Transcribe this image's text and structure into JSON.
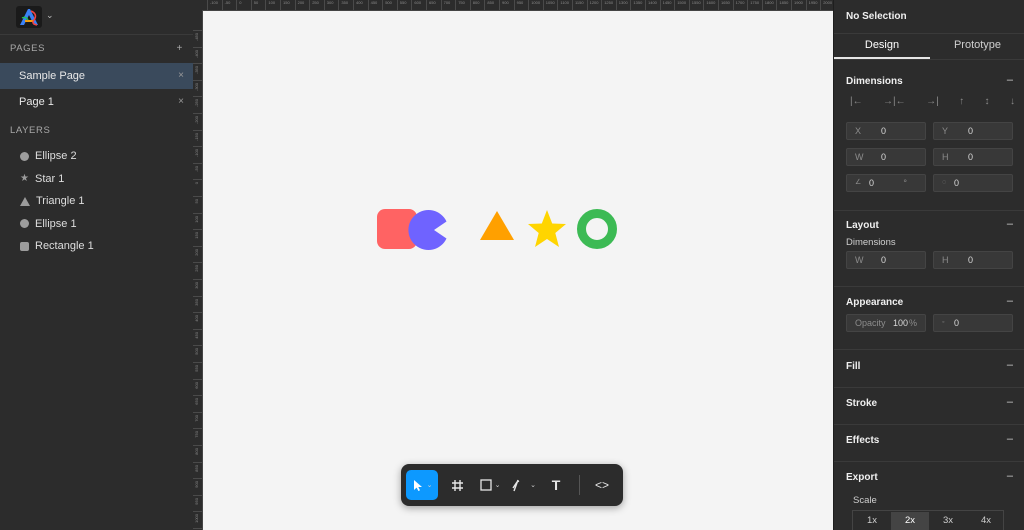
{
  "colors": {
    "canvas_bg": "#f4f4f4",
    "panel_bg": "#2c2c2c",
    "selected_page_bg": "#3a4a5c",
    "accent": "#0d99ff",
    "square": "#ff6363",
    "pacman": "#6f63ff",
    "triangle": "#ffa000",
    "star": "#ffd500",
    "ring": "#3cba54"
  },
  "sidebar": {
    "logo_icon": "app-logo",
    "pages_heading": "PAGES",
    "add_page": "+",
    "pages": [
      {
        "label": "Sample Page",
        "close": "×",
        "active": true
      },
      {
        "label": "Page 1",
        "close": "×",
        "active": false
      }
    ],
    "layers_heading": "LAYERS",
    "layers": [
      {
        "label": "Ellipse 2",
        "icon": "ellipse-icon"
      },
      {
        "label": "Star 1",
        "icon": "star-icon"
      },
      {
        "label": "Triangle 1",
        "icon": "triangle-icon"
      },
      {
        "label": "Ellipse 1",
        "icon": "ellipse-icon"
      },
      {
        "label": "Rectangle 1",
        "icon": "rectangle-icon"
      }
    ]
  },
  "ruler": {
    "top_labels": [
      "-100",
      "-50",
      "0",
      "50",
      "100",
      "150",
      "200",
      "250",
      "300",
      "350",
      "400",
      "450",
      "500",
      "550",
      "600",
      "650",
      "700",
      "750",
      "800",
      "850",
      "900",
      "950",
      "1000",
      "1050",
      "1100",
      "1150",
      "1200",
      "1250",
      "1300",
      "1350",
      "1400",
      "1450",
      "1500",
      "1550",
      "1600",
      "1650",
      "1700",
      "1750",
      "1800",
      "1850",
      "1900",
      "1950",
      "2000",
      "2050"
    ],
    "left_labels": [
      "-450",
      "-400",
      "-350",
      "-300",
      "-250",
      "-200",
      "-150",
      "-100",
      "-50",
      "0",
      "50",
      "100",
      "150",
      "200",
      "250",
      "300",
      "350",
      "400",
      "450",
      "500",
      "550",
      "600",
      "650",
      "700",
      "750",
      "800",
      "850",
      "900",
      "950",
      "1000",
      "1050"
    ]
  },
  "toolbar": {
    "tools": [
      {
        "name": "select-tool",
        "icon": "cursor-icon",
        "has_caret": true,
        "active": true
      },
      {
        "name": "frame-tool",
        "icon": "frame-icon",
        "has_caret": false,
        "active": false
      },
      {
        "name": "shape-tool",
        "icon": "rectangle-icon",
        "has_caret": true,
        "active": false
      },
      {
        "name": "pen-tool",
        "icon": "pen-icon",
        "has_caret": true,
        "active": false
      },
      {
        "name": "text-tool",
        "icon": "text-icon",
        "has_caret": false,
        "active": false
      },
      {
        "name": "code-tool",
        "icon": "code-icon",
        "has_caret": false,
        "active": false
      }
    ],
    "text_glyph": "T",
    "code_glyph": "<>"
  },
  "right_panel": {
    "selection_title": "No Selection",
    "tabs": [
      "Design",
      "Prototype"
    ],
    "dimensions": {
      "title": "Dimensions",
      "toggle": "–",
      "x_label": "X",
      "x_value": "0",
      "y_label": "Y",
      "y_value": "0",
      "w_label": "W",
      "w_value": "0",
      "h_label": "H",
      "h_value": "0",
      "rotation_value": "0",
      "rotation_unit": "°",
      "radius_value": "0"
    },
    "layout": {
      "title": "Layout",
      "toggle": "–",
      "sub": "Dimensions",
      "w_label": "W",
      "w_value": "0",
      "h_label": "H",
      "h_value": "0"
    },
    "appearance": {
      "title": "Appearance",
      "toggle": "–",
      "opacity_label": "Opacity",
      "opacity_value": "100",
      "opacity_unit": "%",
      "corner_value": "0"
    },
    "fill": {
      "title": "Fill",
      "toggle": "–"
    },
    "stroke": {
      "title": "Stroke",
      "toggle": "–"
    },
    "effects": {
      "title": "Effects",
      "toggle": "–"
    },
    "export": {
      "title": "Export",
      "toggle": "–",
      "scale_label": "Scale",
      "scales": [
        "1x",
        "2x",
        "3x",
        "4x"
      ],
      "selected_scale": "2x"
    }
  }
}
